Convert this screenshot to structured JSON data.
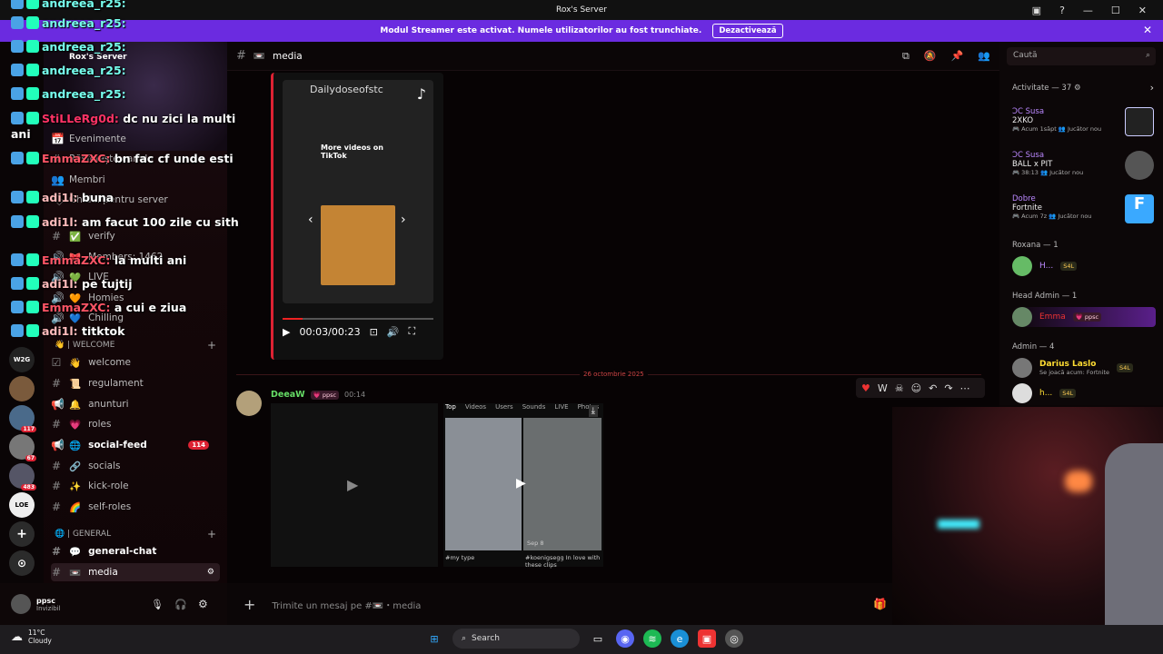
{
  "window": {
    "title": "Rox's Server",
    "controls": [
      "▣",
      "?",
      "—",
      "☐",
      "✕"
    ]
  },
  "banner": {
    "text": "Modul Streamer este activat. Numele utilizatorilor au fost trunchiate.",
    "button": "Dezactivează",
    "close": "✕"
  },
  "server": {
    "name": "Rox's Server"
  },
  "sidebar": {
    "items": [
      {
        "label": "Evenimente",
        "icon": "📅"
      },
      {
        "label": "Răsfoiește canale",
        "icon": "#"
      },
      {
        "label": "Membri",
        "icon": "👥"
      },
      {
        "label": "Ghidul pentru server",
        "icon": "🏷"
      }
    ],
    "channels_top": [
      {
        "label": "verify",
        "emoji": "✅"
      },
      {
        "label": "Members: 1462",
        "emoji": "🎀"
      },
      {
        "label": "LIVE",
        "emoji": "💚"
      },
      {
        "label": "Homies",
        "emoji": "🧡"
      },
      {
        "label": "Chilling",
        "emoji": "💙"
      }
    ],
    "cat_welcome": "👋 | WELCOME",
    "welcome": [
      {
        "label": "welcome",
        "emoji": "👋"
      },
      {
        "label": "regulament",
        "emoji": "📜"
      },
      {
        "label": "anunturi",
        "emoji": "🔔"
      },
      {
        "label": "roles",
        "emoji": "💗"
      },
      {
        "label": "social-feed",
        "emoji": "🌐",
        "badge": "114"
      },
      {
        "label": "socials",
        "emoji": "🔗"
      },
      {
        "label": "kick-role",
        "emoji": "✨"
      },
      {
        "label": "self-roles",
        "emoji": "🌈"
      }
    ],
    "cat_general": "🌐 | GENERAL",
    "general": [
      {
        "label": "general-chat",
        "emoji": "💬"
      },
      {
        "label": "media",
        "emoji": "📼"
      }
    ]
  },
  "user": {
    "name": "ppsc",
    "status": "Invizibil"
  },
  "rail": {
    "badges": [
      "117",
      "67",
      "483"
    ]
  },
  "header": {
    "channel": "media",
    "emoji": "📼"
  },
  "tiktok": {
    "account": "Dailydoseofstc",
    "more": "More videos on TikTok",
    "time": "00:03/00:23",
    "logo": "♪"
  },
  "date_separator": "26 octombrie 2025",
  "message": {
    "author": "DeeaW",
    "tag": "💗 ppsc",
    "time": "00:14"
  },
  "tiktok2": {
    "tabs": [
      "Top",
      "Videos",
      "Users",
      "Sounds",
      "LIVE",
      "Photos"
    ],
    "cap1": "#my type",
    "cap2": "#koenigsegg In love with these clips",
    "date": "Sep 8"
  },
  "composer": {
    "placeholder": "Trimite un mesaj pe #📼・media"
  },
  "members": {
    "search": "Caută",
    "activity_header": "Activitate — 37 ⚙",
    "activities": [
      {
        "name": "ƆC Susa",
        "game": "2XKO",
        "meta": "🎮 Acum 1săpt  👥 Jucător nou"
      },
      {
        "name": "ƆC Susa",
        "game": "BALL x PIT",
        "meta": "🎮 38:13  👥 Jucător nou"
      },
      {
        "name": "Dobre",
        "game": "Fortnite",
        "meta": "🎮 Acum 7z  👥 Jucător nou"
      }
    ],
    "group1": "Roxana — 1",
    "m1": {
      "name": "H...",
      "tag": "S4L"
    },
    "group2": "Head Admin — 1",
    "m2": {
      "name": "Emma",
      "tag": "💗 ppsc"
    },
    "group3": "Admin — 4",
    "m3": {
      "name": "Darius Laslo",
      "tag": "S4L",
      "sub": "Se joacă acum: Fortnite"
    },
    "m4": {
      "name": "h...",
      "tag": "S4L"
    }
  },
  "taskbar": {
    "temp": "11°C",
    "weather": "Cloudy",
    "search": "Search"
  },
  "chat_overlay": [
    {
      "user": "andreea_r25:",
      "text": "",
      "cls": "n-and"
    },
    {
      "user": "andreea_r25:",
      "text": "",
      "cls": "n-and"
    },
    {
      "user": "andreea_r25:",
      "text": "",
      "cls": "n-and"
    },
    {
      "user": "andreea_r25:",
      "text": "",
      "cls": "n-and"
    },
    {
      "user": "StiLLeRg0d:",
      "text": "dc nu zici la multi ani",
      "cls": "n-sti"
    },
    {
      "user": "EmmaZXC:",
      "text": "bn fac cf unde esti",
      "cls": "n-emm"
    },
    {
      "user": "adi1l:",
      "text": "buna",
      "cls": "n-adi"
    },
    {
      "user": "adi1l:",
      "text": "am facut 100 zile cu sith",
      "cls": "n-adi"
    },
    {
      "user": "EmmaZXC:",
      "text": "la multi ani",
      "cls": "n-emm"
    },
    {
      "user": "adi1l:",
      "text": "pe tujtij",
      "cls": "n-adi"
    },
    {
      "user": "EmmaZXC:",
      "text": "a cui e ziua",
      "cls": "n-emm"
    },
    {
      "user": "adi1l:",
      "text": "titktok",
      "cls": "n-adi"
    }
  ]
}
